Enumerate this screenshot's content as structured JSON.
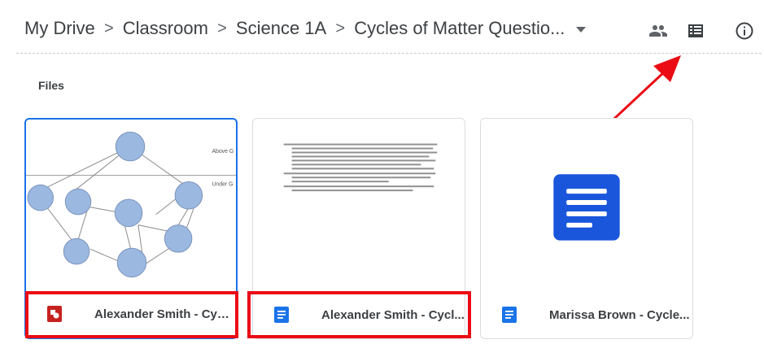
{
  "breadcrumb": {
    "items": [
      "My Drive",
      "Classroom",
      "Science 1A",
      "Cycles of Matter Questio..."
    ],
    "separator": ">"
  },
  "header": {
    "icons": [
      "people-icon",
      "list-view-icon",
      "info-icon"
    ]
  },
  "section": {
    "label": "Files"
  },
  "files": [
    {
      "title": "Alexander Smith - Cycl...",
      "type": "drawing",
      "icon_color": "#c5221f",
      "selected": true
    },
    {
      "title": "Alexander Smith - Cycl...",
      "type": "document",
      "icon_color": "#1a73e8",
      "selected": false
    },
    {
      "title": "Marissa Brown - Cycle...",
      "type": "document",
      "icon_color": "#1a73e8",
      "selected": false
    }
  ],
  "thumbnail_text": {
    "drawing_above": "Above G",
    "drawing_under": "Under G"
  },
  "annotation": {
    "color": "#ea0b14"
  }
}
